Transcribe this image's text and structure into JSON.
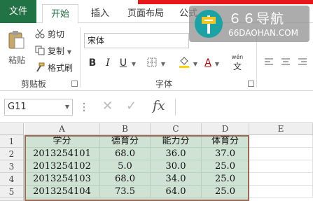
{
  "ribbon_tabs": {
    "file": "文件",
    "home": "开始",
    "insert": "插入",
    "page_layout": "页面布局",
    "formulas_partial": "公式"
  },
  "clipboard": {
    "paste": "粘贴",
    "cut": "剪切",
    "copy": "复制",
    "format_painter": "格式刷",
    "group_label": "剪贴板"
  },
  "font": {
    "name": "宋体",
    "bold": "B",
    "italic": "I",
    "underline": "U",
    "font_color": "A",
    "wen_label": "wén",
    "wen_char": "文",
    "group_label": "字体"
  },
  "watermark": {
    "title": "６６导航",
    "subtitle": "66DAOHAN.COM"
  },
  "formula_bar": {
    "name_box": "G11",
    "fx": "fx",
    "formula": ""
  },
  "sheet": {
    "columns": [
      "A",
      "B",
      "C",
      "D",
      "E"
    ],
    "rows": [
      {
        "num": "1",
        "cells": [
          "学分",
          "德育分",
          "能力分",
          "体育分",
          ""
        ]
      },
      {
        "num": "2",
        "cells": [
          "2013254101",
          "68.0",
          "36.0",
          "37.0",
          ""
        ]
      },
      {
        "num": "3",
        "cells": [
          "2013254102",
          "5.0",
          "30.0",
          "25.0",
          ""
        ]
      },
      {
        "num": "4",
        "cells": [
          "2013254103",
          "68.0",
          "34.0",
          "25.0",
          ""
        ]
      },
      {
        "num": "5",
        "cells": [
          "2013254104",
          "73.5",
          "64.0",
          "25.0",
          ""
        ]
      }
    ]
  },
  "colors": {
    "excel_green": "#217346",
    "selection_fill": "#cfe2d4",
    "selection_border": "#9a6b54",
    "red_bar": "#e8171a",
    "watermark_teal": "#1aa2a5"
  }
}
